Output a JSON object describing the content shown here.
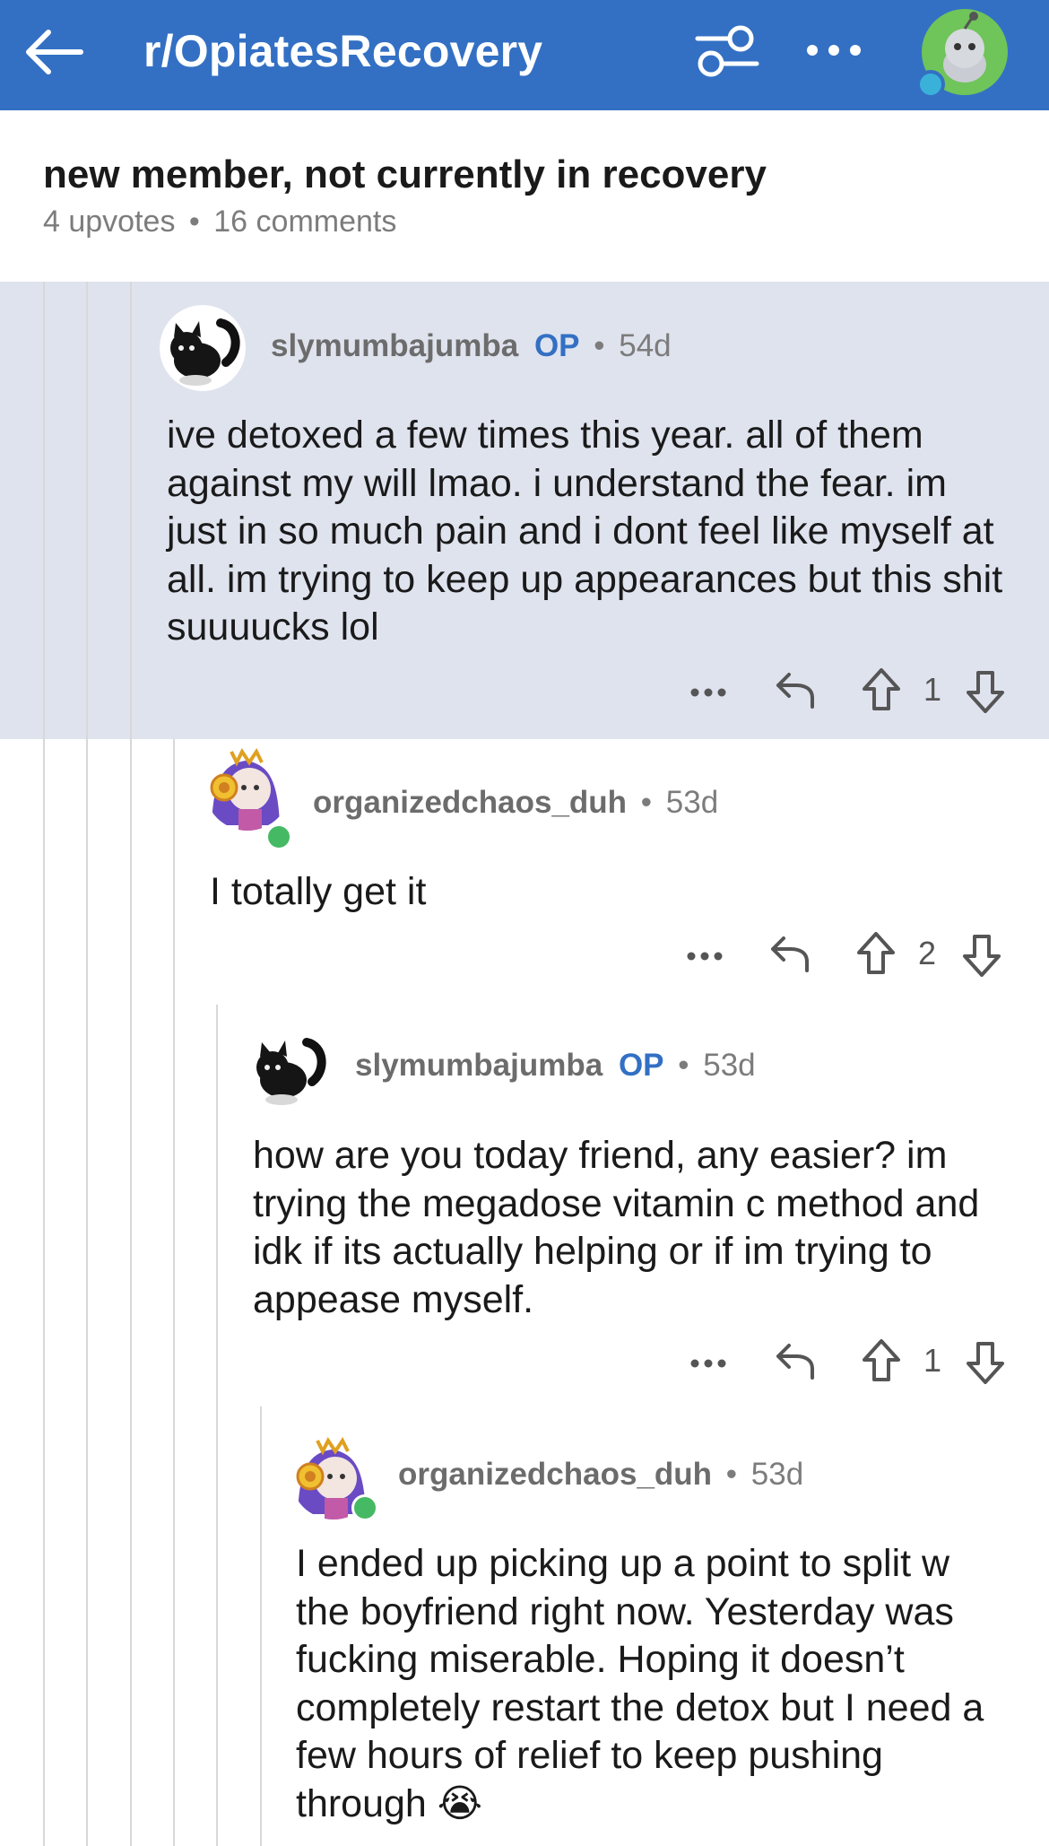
{
  "header": {
    "subreddit": "r/OpiatesRecovery",
    "colors": {
      "bar": "#3370c4",
      "accent": "#3370c4",
      "online": "#46b964"
    },
    "icons": [
      "back-arrow-icon",
      "filter-sort-icon",
      "more-icon",
      "profile-avatar-icon"
    ]
  },
  "post": {
    "title": "new member, not currently in recovery",
    "upvotes": "4 upvotes",
    "separator": "•",
    "comments": "16 comments"
  },
  "comments": [
    {
      "author": "slymumbajumba",
      "op_badge": "OP",
      "separator": "•",
      "age": "54d",
      "body": "ive detoxed a few times this year. all of them against my will lmao. i understand the fear. im just in so much pain and i dont feel like myself at all. im trying to keep up appearances but this shit suuuucks lol",
      "votes": "1",
      "highlighted": true
    },
    {
      "author": "organizedchaos_duh",
      "separator": "•",
      "age": "53d",
      "body": "I totally get it",
      "votes": "2"
    },
    {
      "author": "slymumbajumba",
      "op_badge": "OP",
      "separator": "•",
      "age": "53d",
      "body": "how are you today friend, any easier? im trying the megadose vitamin c method and idk if its actually helping or if im trying to appease myself.",
      "votes": "1"
    },
    {
      "author": "organizedchaos_duh",
      "separator": "•",
      "age": "53d",
      "body": "I ended up picking up a point to split w the boyfriend right now. Yesterday was fucking miserable. Hoping it doesn’t completely restart the detox but I need a few hours of relief to keep pushing through 😭"
    }
  ]
}
